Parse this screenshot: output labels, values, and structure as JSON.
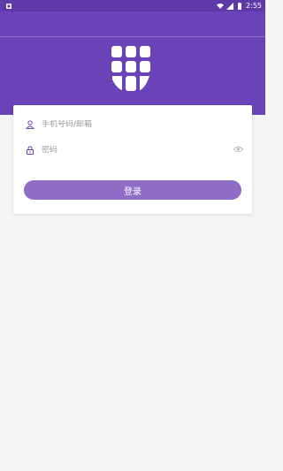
{
  "status_bar": {
    "time": "2:55",
    "icons": [
      "notification-icon",
      "wifi-icon",
      "signal-icon",
      "battery-icon"
    ]
  },
  "theme": {
    "primary": "#6a43b8",
    "status_bar": "#5e3aa8",
    "button": "#8e6dc7",
    "background": "#f5f5f5"
  },
  "logo": {
    "icon": "keypad-logo-icon"
  },
  "login_form": {
    "username_placeholder": "手机号码/邮箱",
    "username_value": "",
    "password_placeholder": "密码",
    "password_value": "",
    "user_icon": "user-icon",
    "lock_icon": "lock-icon",
    "eye_icon": "eye-icon",
    "submit_label": "登录"
  }
}
